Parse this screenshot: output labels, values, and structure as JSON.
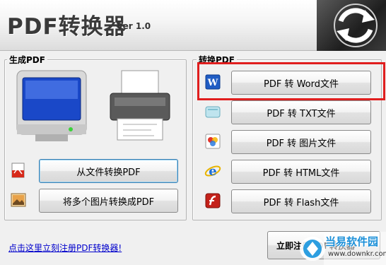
{
  "header": {
    "title": "PDF转换器",
    "version": "Ver 1.0"
  },
  "left_group": {
    "title": "生成PDF",
    "buttons": [
      {
        "label": "从文件转换PDF",
        "icon": "pdf-document-icon"
      },
      {
        "label": "将多个图片转换成PDF",
        "icon": "picture-icon"
      }
    ]
  },
  "right_group": {
    "title": "转换PDF",
    "buttons": [
      {
        "label": "PDF 转 Word文件",
        "icon": "word-icon"
      },
      {
        "label": "PDF 转 TXT文件",
        "icon": "txt-icon"
      },
      {
        "label": "PDF 转 图片文件",
        "icon": "image-icon"
      },
      {
        "label": "PDF 转 HTML文件",
        "icon": "ie-icon"
      },
      {
        "label": "PDF 转 Flash文件",
        "icon": "flash-icon"
      }
    ]
  },
  "footer": {
    "register_link": "点击这里立刻注册PDF转换器!",
    "register_button": "立即注册PDF转换器"
  },
  "watermark": {
    "text": "当易软件园",
    "url": "www.downkr.com"
  },
  "colors": {
    "highlight": "#e01e1e",
    "link": "#0000cc",
    "watermark": "#1a8fd8"
  }
}
